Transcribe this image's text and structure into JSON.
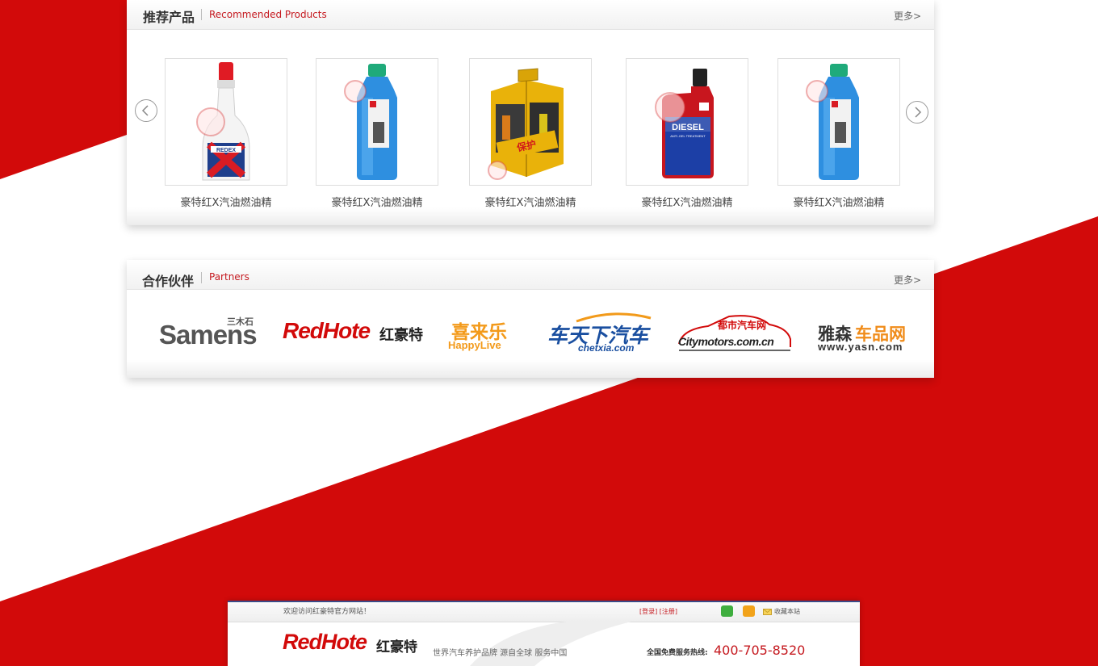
{
  "colors": {
    "brand_red": "#d20a0a",
    "accent_text_red": "#c5191f"
  },
  "recommended": {
    "title": "推荐产品",
    "subtitle": "Recommended Products",
    "more": "更多>",
    "products": [
      {
        "name": "豪特红X汽油燃油精",
        "image": "redex-fuel-bottle"
      },
      {
        "name": "豪特红X汽油燃油精",
        "image": "blue-washer-fluid-bottle"
      },
      {
        "name": "豪特红X汽油燃油精",
        "image": "yellow-gift-box"
      },
      {
        "name": "豪特红X汽油燃油精",
        "image": "diesel-anti-gel-bottle"
      },
      {
        "name": "豪特红X汽油燃油精",
        "image": "blue-washer-fluid-bottle"
      }
    ]
  },
  "partners": {
    "title": "合作伙伴",
    "subtitle": "Partners",
    "more": "更多>",
    "logos": {
      "samens": {
        "top": "三木石",
        "main": "Samens"
      },
      "redhote": {
        "main": "RedHote",
        "cn": "红豪特"
      },
      "happylive": {
        "cn": "喜来乐",
        "en": "HappyLive"
      },
      "chetxia": {
        "cn": "车天下汽车",
        "en": "chetxia.com"
      },
      "citymotors": {
        "cn": "都市汽车网",
        "en": "Citymotors.com.cn"
      },
      "yasn": {
        "cn1": "雅森",
        "cn2": "车品网",
        "en": "www.yasn.com"
      }
    }
  },
  "site_header": {
    "welcome": "欢迎访问红豪特官方网站！",
    "auth": "[登录] [注册]",
    "favorite": "收藏本站",
    "logo_main": "RedHote",
    "logo_cn": "红豪特",
    "slogan": "世界汽车养护品牌  源自全球  服务中国",
    "hotline_label": "全国免费服务热线:",
    "hotline": "400-705-8520"
  }
}
